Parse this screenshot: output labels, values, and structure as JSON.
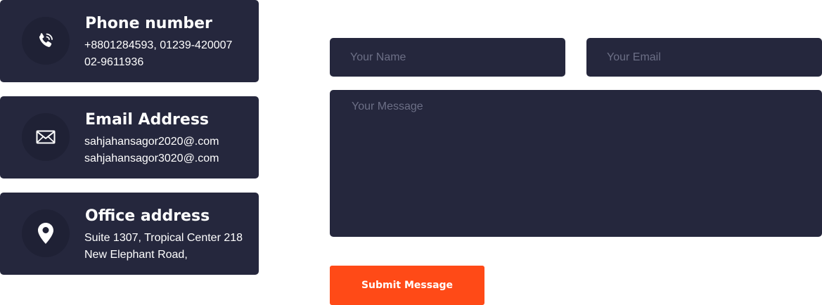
{
  "contact_info": {
    "phone": {
      "icon": "phone-icon",
      "title": "Phone number",
      "line1": "+8801284593, 01239-420007",
      "line2": "02-9611936"
    },
    "email": {
      "icon": "envelope-icon",
      "title": "Email Address",
      "line1": "sahjahansagor2020@.com",
      "line2": "sahjahansagor3020@.com"
    },
    "office": {
      "icon": "map-pin-icon",
      "title": "Office address",
      "line1": "Suite 1307, Tropical Center 218",
      "line2": "New Elephant Road,"
    }
  },
  "form": {
    "name_placeholder": "Your Name",
    "email_placeholder": "Your Email",
    "message_placeholder": "Your Message",
    "submit_label": "Submit Message"
  },
  "colors": {
    "card_bg": "#25273d",
    "accent": "#ff4a17",
    "placeholder": "#6c6f86"
  }
}
